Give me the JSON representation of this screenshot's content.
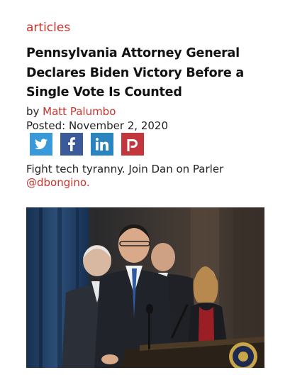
{
  "article": {
    "category": "articles",
    "title": "Pennsylvania Attorney General Declares Biden Victory Before a Single Vote Is Counted",
    "by_prefix": "by ",
    "author": "Matt Palumbo",
    "posted": "Posted: November 2, 2020"
  },
  "share": {
    "buttons": [
      {
        "icon": "twitter-icon",
        "color": "#3a9ad9"
      },
      {
        "icon": "facebook-icon",
        "color": "#3b5a99"
      },
      {
        "icon": "linkedin-icon",
        "color": "#2a84c0"
      },
      {
        "icon": "parler-icon",
        "color": "#c1373b"
      }
    ]
  },
  "promo": {
    "text": "Fight tech tyranny. Join Dan on Parler",
    "handle": "@dbongino."
  },
  "colors": {
    "accent": "#c8322c"
  }
}
